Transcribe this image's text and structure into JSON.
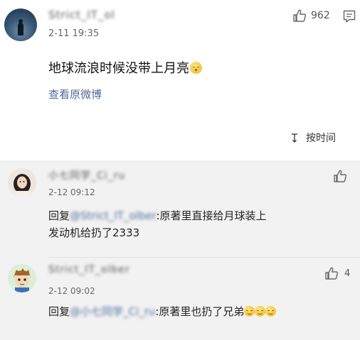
{
  "post": {
    "username": "Strict_IT_ol",
    "timestamp": "2-11 19:35",
    "text": "地球流浪时候没带上月亮",
    "view_original": "查看原微博",
    "like_count": "962",
    "sort_label": "按时间"
  },
  "replies": [
    {
      "username": "小七同学_Ci_ru",
      "timestamp": "2-12 09:12",
      "text_prefix": "回复",
      "mention": "@Strict_IT_olber",
      "text_line1_suffix": ":原著里直接给月球装上",
      "text_line2": "发动机给扔了2333",
      "like_count": ""
    },
    {
      "username": "Strict_IT_olber",
      "timestamp": "2-12 09:02",
      "text_prefix": "回复",
      "mention": "@小七同学_Ci_ru",
      "text_suffix": ":原著里也扔了兄弟",
      "like_count": "4"
    }
  ],
  "icons": {
    "like": "thumbs-up-icon",
    "comment": "comment-icon",
    "sort": "sort-icon",
    "emoji": "smile-emoji"
  },
  "colors": {
    "link": "#4f6b9c",
    "reply_bg": "#f2f2f2"
  }
}
